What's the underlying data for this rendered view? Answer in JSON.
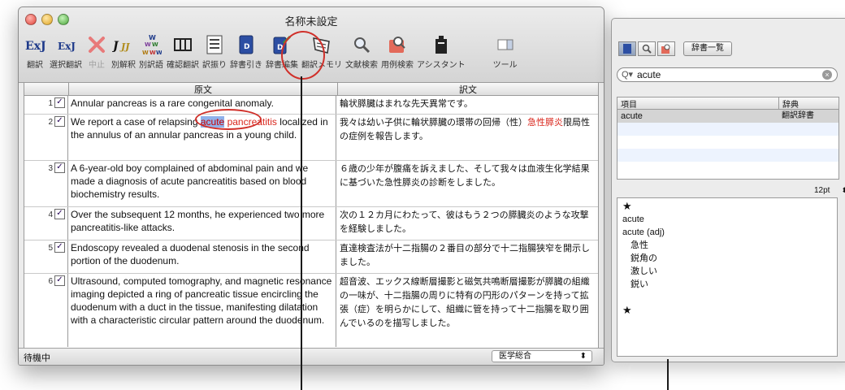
{
  "window": {
    "title": "名称未設定",
    "toolbar": [
      {
        "name": "translate",
        "label": "翻訳",
        "disabled": false
      },
      {
        "name": "select-translate",
        "label": "選択翻訳",
        "disabled": false
      },
      {
        "name": "stop",
        "label": "中止",
        "disabled": true
      },
      {
        "name": "alt-translation",
        "label": "別解釈",
        "disabled": false
      },
      {
        "name": "alt-word",
        "label": "別訳語",
        "disabled": false
      },
      {
        "name": "confirm-translate",
        "label": "確認翻訳",
        "disabled": false
      },
      {
        "name": "reading",
        "label": "訳振り",
        "disabled": false
      },
      {
        "name": "dict-lookup",
        "label": "辞書引き",
        "disabled": false
      },
      {
        "name": "dict-edit",
        "label": "辞書編集",
        "disabled": false
      },
      {
        "name": "translation-memory",
        "label": "翻訳メモリ",
        "disabled": false
      },
      {
        "name": "doc-search",
        "label": "文献検索",
        "disabled": false
      },
      {
        "name": "example-search",
        "label": "用例検索",
        "disabled": false
      },
      {
        "name": "assistant",
        "label": "アシスタント",
        "disabled": false
      },
      {
        "name": "tools",
        "label": "ツール",
        "disabled": false
      }
    ],
    "table": {
      "col_source": "原文",
      "col_translation": "訳文",
      "rows": [
        {
          "num": "1",
          "src": "Annular pancreas is a rare congenital anomaly.",
          "tr": "輪状膵臓はまれな先天異常です。"
        },
        {
          "num": "2",
          "src_before": "We report a case of relapsing ",
          "src_highlight": "acute",
          "src_red": " pancreatitis",
          "src_after": " localized in the annulus of an annular pancreas in a young child.",
          "tr_before": "我々は幼い子供に輪状膵臓の環帯の回帰（性）",
          "tr_red": "急性膵炎",
          "tr_after": "限局性の症例を報告します。"
        },
        {
          "num": "3",
          "src": "A 6-year-old boy complained of abdominal pain and we made a diagnosis of acute pancreatitis based on blood biochemistry results.",
          "tr": "６歳の少年が腹痛を訴えました、そして我々は血液生化学結果に基づいた急性膵炎の診断をしました。"
        },
        {
          "num": "4",
          "src": "Over the subsequent 12 months, he experienced two more pancreatitis-like attacks.",
          "tr": "次の１２カ月にわたって、彼はもう２つの膵臓炎のような攻撃を経験しました。"
        },
        {
          "num": "5",
          "src": "Endoscopy revealed a duodenal stenosis in the second portion of the duodenum.",
          "tr": "直達検査法が十二指腸の２番目の部分で十二指腸狭窄を開示しました。"
        },
        {
          "num": "6",
          "src": "Ultrasound, computed tomography, and magnetic resonance imaging depicted a ring of pancreatic tissue encircling the duodenum with a duct in the tissue, manifesting dilatation with a characteristic circular pattern around the duodenum.",
          "tr": "超音波、エックス線断層撮影と磁気共鳴断層撮影が膵臓の組織の一味が、十二指腸の周りに特有の円形のパターンを持って拡張（症）を明らかにして、組織に管を持って十二指腸を取り囲んでいるのを描写しました。"
        }
      ]
    },
    "status": {
      "left": "待機中",
      "dictionary_select": "医学総合"
    }
  },
  "panel": {
    "dict_list_button": "辞書一覧",
    "search_value": "acute",
    "list": {
      "col_item": "項目",
      "col_dict": "辞典",
      "rows": [
        {
          "item": "acute",
          "dict": "翻訳辞書"
        }
      ]
    },
    "font_size": "12pt",
    "definition": {
      "star": "★",
      "head": "acute",
      "pos": "acute (adj)",
      "senses": [
        "急性",
        "鋭角の",
        "激しい",
        "鋭い"
      ]
    }
  },
  "colors": {
    "highlight_blue": "#8fb1ea",
    "accent_red": "#d9261c",
    "annotation_ring": "#d0302a"
  }
}
